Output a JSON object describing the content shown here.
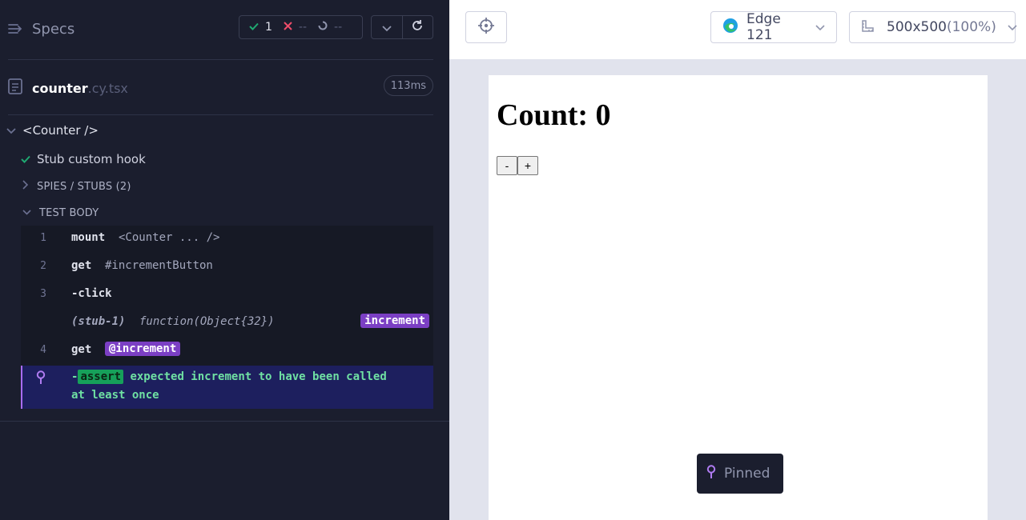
{
  "reporter": {
    "specs_label": "Specs",
    "stats": {
      "passed": "1",
      "failed": "--",
      "pending": "--"
    },
    "file": {
      "name": "counter",
      "ext": ".cy.tsx",
      "duration": "113ms"
    },
    "suite": "<Counter />",
    "test": "Stub custom hook",
    "sections": {
      "spies": "SPIES / STUBS (2)",
      "body": "TEST BODY"
    },
    "commands": [
      {
        "num": "1",
        "name": "mount",
        "message": "<Counter ... />"
      },
      {
        "num": "2",
        "name": "get",
        "message": "#incrementButton"
      },
      {
        "num": "3",
        "name": "-click",
        "message": ""
      },
      {
        "num": "",
        "name": "(stub-1)",
        "message": "function(Object{32})",
        "alias": "increment"
      },
      {
        "num": "4",
        "name": "get",
        "alias": "@increment"
      }
    ],
    "assert": {
      "prefix": "-",
      "badge": "assert",
      "line1": "expected increment to have been called",
      "line2": "at least once"
    }
  },
  "aut": {
    "browser": "Edge 121",
    "viewport": "500x500",
    "scale": "(100%)",
    "heading": "Count: 0",
    "minus": "-",
    "plus": "+",
    "toast": "Pinned"
  },
  "colors": {
    "reporter_bg": "#1b1e2e",
    "pass": "#1fa971",
    "fail": "#f04d6a",
    "alias": "#7b3fc4",
    "assert": "#16a05a",
    "pinned_row": "#1d1f5e"
  }
}
